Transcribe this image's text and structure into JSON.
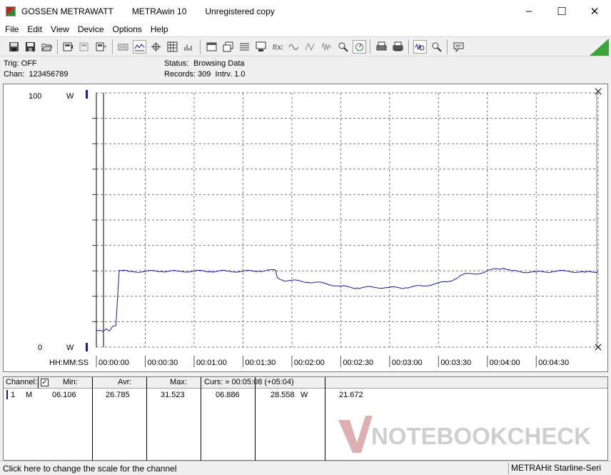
{
  "window": {
    "title_parts": [
      "GOSSEN METRAWATT",
      "METRAwin 10",
      "Unregistered copy"
    ],
    "controls": [
      "–",
      "☐",
      "✕"
    ]
  },
  "menu": [
    "File",
    "Edit",
    "View",
    "Device",
    "Options",
    "Help"
  ],
  "info": {
    "trig": "Trig: OFF",
    "chan": "Chan:  123456789",
    "status_label": "Status:",
    "status_value": "Browsing Data",
    "records": "Records: 309  Intrv. 1.0"
  },
  "chart_data": {
    "type": "line",
    "ylim": [
      0,
      100
    ],
    "y_top_label": "100",
    "y_bottom_label": "0",
    "y_unit": "W",
    "x_label": "HH:MM:SS",
    "x_ticks": [
      "00:00:00",
      "00:00:30",
      "00:01:00",
      "00:01:30",
      "00:02:00",
      "00:02:30",
      "00:03:00",
      "00:03:30",
      "00:04:00",
      "00:04:30"
    ],
    "x_range_seconds": [
      0,
      308
    ],
    "grid": true,
    "series": [
      {
        "color": "#1a1aa0",
        "x": [
          0,
          4,
          6,
          8,
          10,
          12,
          14,
          20,
          30,
          40,
          50,
          60,
          70,
          80,
          90,
          100,
          110,
          111,
          114,
          120,
          130,
          140,
          150,
          160,
          170,
          180,
          190,
          200,
          210,
          215,
          220,
          225,
          230,
          238,
          245,
          250,
          255,
          260,
          270,
          280,
          290,
          300,
          308
        ],
        "y": [
          6.5,
          6.1,
          7.2,
          6.3,
          8.2,
          8.5,
          30.2,
          29.7,
          29.8,
          29.9,
          29.8,
          29.9,
          29.8,
          29.9,
          29.8,
          30.0,
          30.2,
          27.4,
          26.4,
          26.2,
          25.6,
          25.1,
          23.9,
          23.3,
          23.6,
          23.4,
          23.4,
          24.1,
          25.1,
          25.7,
          26.8,
          28.5,
          28.9,
          29.3,
          30.9,
          31.1,
          29.9,
          29.7,
          29.5,
          29.8,
          29.9,
          29.4,
          29.7
        ]
      }
    ]
  },
  "table": {
    "headers": {
      "channel": "Channel:",
      "min": "Min:",
      "avr": "Avr:",
      "max": "Max:",
      "curs": "Curs: » 00:05:08 (+05:04)"
    },
    "rows": [
      {
        "id": "1",
        "mode": "M",
        "min": "06.106",
        "avr": "26.785",
        "max": "31.523",
        "curs1": "06.886",
        "curs2": "28.558",
        "unit": "W",
        "curs3": "21.672"
      }
    ]
  },
  "watermark": "NOTEBOOKCHECK",
  "status": {
    "left": "Click here to change the scale for the channel",
    "right": "METRAHit Starline-Seri"
  }
}
